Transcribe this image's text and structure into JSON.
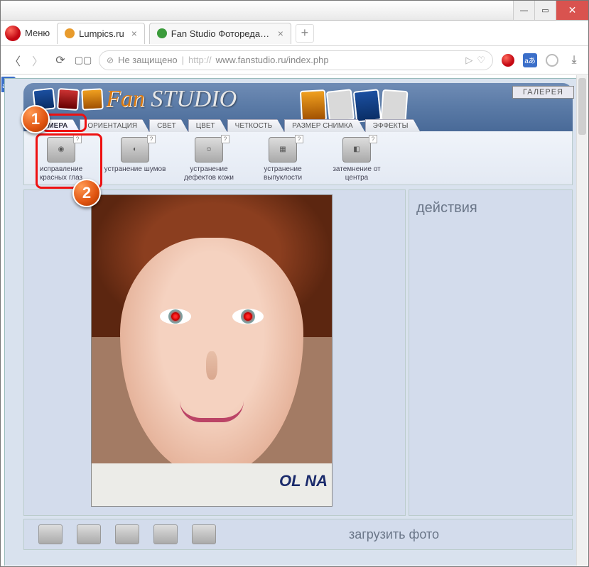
{
  "browser": {
    "menu_label": "Меню",
    "tabs": [
      {
        "title": "Lumpics.ru",
        "favicon_color": "#e89b2c"
      },
      {
        "title": "Fan Studio Фоторедактор",
        "favicon_color": "#3b9b3b"
      }
    ],
    "insecure_label": "Не защищено",
    "url_prefix": "http://",
    "url_rest": "www.fanstudio.ru/index.php"
  },
  "logo": {
    "fan": "Fan",
    "studio": "STUDIO"
  },
  "gallery_label": "ГАЛЕРЕЯ",
  "tabs": [
    {
      "label": "КАМЕРА",
      "active": true
    },
    {
      "label": "ОРИЕНТАЦИЯ",
      "active": false
    },
    {
      "label": "СВЕТ",
      "active": false
    },
    {
      "label": "ЦВЕТ",
      "active": false
    },
    {
      "label": "ЧЕТКОСТЬ",
      "active": false
    },
    {
      "label": "РАЗМЕР СНИМКА",
      "active": false
    },
    {
      "label": "ЭФФЕКТЫ",
      "active": false
    }
  ],
  "tools": [
    {
      "label": "исправление красных глаз"
    },
    {
      "label": "устранение шумов"
    },
    {
      "label": "устранение дефектов кожи"
    },
    {
      "label": "устранение выпуклости"
    },
    {
      "label": "затемнение от центра"
    }
  ],
  "actions_title": "действия",
  "upload_label": "загрузить фото",
  "shirt_text": "OL NA",
  "annotations": {
    "n1": "1",
    "n2": "2"
  }
}
